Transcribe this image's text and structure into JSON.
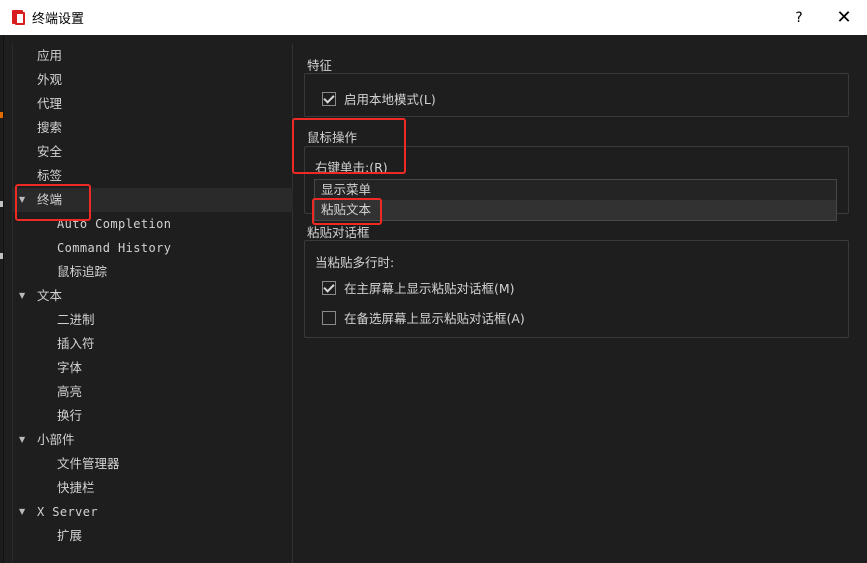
{
  "window": {
    "title": "终端设置",
    "help_label": "?",
    "close_label": "✕",
    "app_icon": "app-logo-icon"
  },
  "sidebar": {
    "items": [
      {
        "label": "应用",
        "level": 0,
        "expandable": false
      },
      {
        "label": "外观",
        "level": 0,
        "expandable": false
      },
      {
        "label": "代理",
        "level": 0,
        "expandable": false
      },
      {
        "label": "搜索",
        "level": 0,
        "expandable": false
      },
      {
        "label": "安全",
        "level": 0,
        "expandable": false
      },
      {
        "label": "标签",
        "level": 0,
        "expandable": false
      },
      {
        "label": "终端",
        "level": 0,
        "expandable": true,
        "expanded": true,
        "selected": true
      },
      {
        "label": "Auto Completion",
        "level": 1,
        "expandable": false
      },
      {
        "label": "Command History",
        "level": 1,
        "expandable": false
      },
      {
        "label": "鼠标追踪",
        "level": 1,
        "expandable": false
      },
      {
        "label": "文本",
        "level": 0,
        "expandable": true,
        "expanded": true
      },
      {
        "label": "二进制",
        "level": 1,
        "expandable": false
      },
      {
        "label": "插入符",
        "level": 1,
        "expandable": false
      },
      {
        "label": "字体",
        "level": 1,
        "expandable": false
      },
      {
        "label": "高亮",
        "level": 1,
        "expandable": false
      },
      {
        "label": "换行",
        "level": 1,
        "expandable": false
      },
      {
        "label": "小部件",
        "level": 0,
        "expandable": true,
        "expanded": true
      },
      {
        "label": "文件管理器",
        "level": 1,
        "expandable": false
      },
      {
        "label": "快捷栏",
        "level": 1,
        "expandable": false
      },
      {
        "label": "X Server",
        "level": 0,
        "expandable": true,
        "expanded": true
      },
      {
        "label": "扩展",
        "level": 1,
        "expandable": false
      }
    ],
    "arrow_glyph": "▼"
  },
  "features": {
    "title": "特征",
    "local_mode": {
      "label": "启用本地模式(L)",
      "checked": true
    }
  },
  "mouse": {
    "title": "鼠标操作",
    "right_click_label": "右键单击:(R)",
    "options": [
      "显示菜单",
      "粘贴文本"
    ],
    "highlighted_option": 1
  },
  "paste_dialog": {
    "title": "粘贴对话框",
    "multiline_label": "当粘贴多行时:",
    "primary": {
      "label": "在主屏幕上显示粘贴对话框(M)",
      "checked": true
    },
    "alternate": {
      "label": "在备选屏幕上显示粘贴对话框(A)",
      "checked": false
    }
  },
  "colors": {
    "annotation": "#ee2a24",
    "background": "#1e1e1e",
    "titlebar": "#ffffff"
  }
}
